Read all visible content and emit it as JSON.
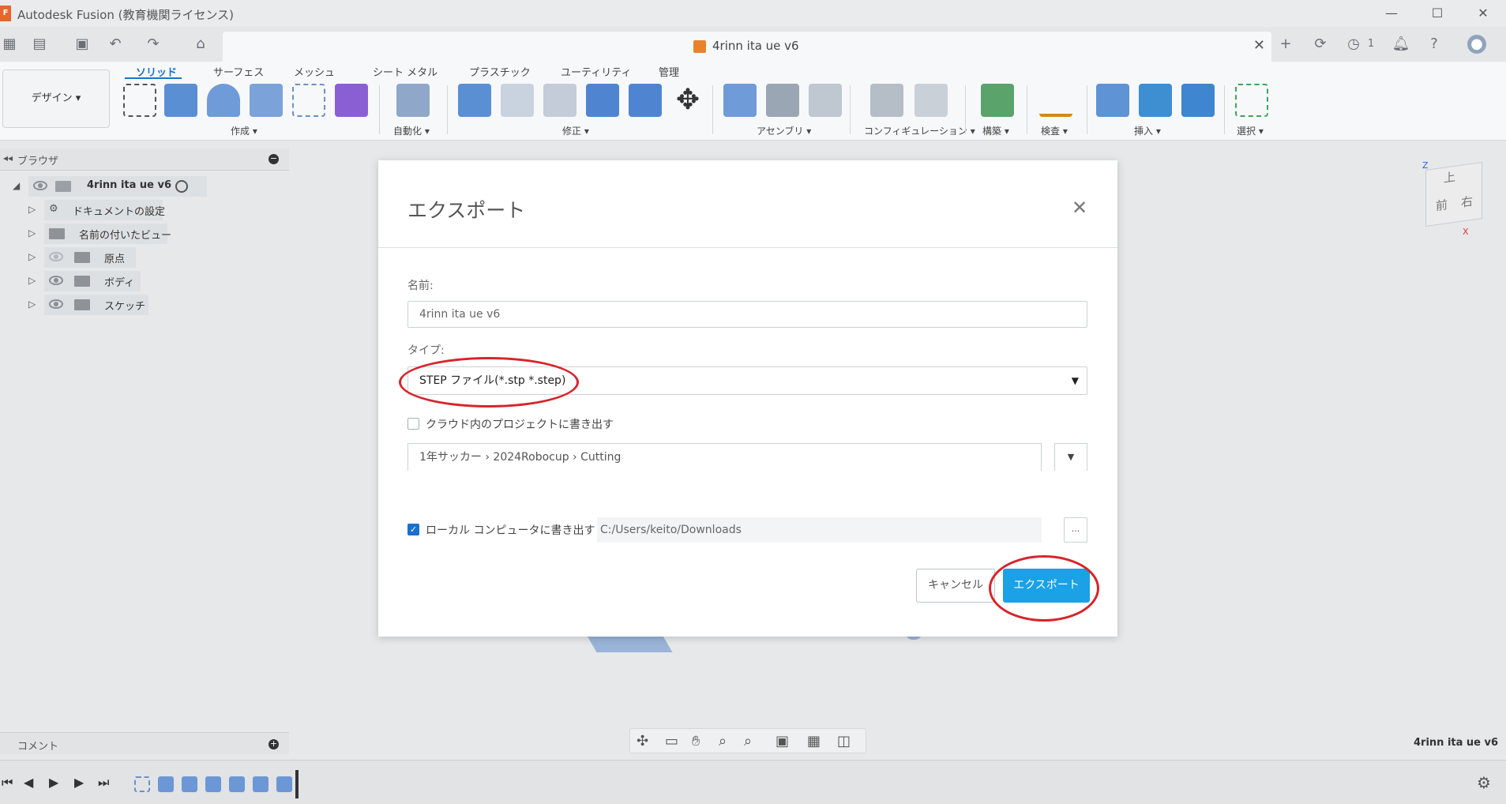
{
  "window": {
    "title": "Autodesk Fusion (教育機関ライセンス)",
    "logo": "F"
  },
  "tabbar": {
    "doc_tab_title": "4rinn ita ue v6",
    "jobs_count": "1"
  },
  "ribbon": {
    "workspace": "デザイン ▾",
    "tabs": [
      "ソリッド",
      "サーフェス",
      "メッシュ",
      "シート メタル",
      "プラスチック",
      "ユーティリティ",
      "管理"
    ],
    "groups": [
      "作成 ▾",
      "自動化 ▾",
      "修正 ▾",
      "アセンブリ ▾",
      "コンフィギュレーション ▾",
      "構築 ▾",
      "検査 ▾",
      "挿入 ▾",
      "選択 ▾"
    ]
  },
  "browser": {
    "title": "ブラウザ",
    "root": "4rinn ita ue v6",
    "items": [
      "ドキュメントの設定",
      "名前の付いたビュー",
      "原点",
      "ボディ",
      "スケッチ"
    ]
  },
  "comments": {
    "label": "コメント"
  },
  "viewcube": {
    "top": "上",
    "front": "前",
    "right": "右",
    "z": "Z",
    "x": "X"
  },
  "viewport": {
    "doc_name": "4rinn ita ue v6"
  },
  "dialog": {
    "title": "エクスポート",
    "name_label": "名前:",
    "name_value": "4rinn ita ue v6",
    "type_label": "タイプ:",
    "type_value": "STEP ファイル(*.stp *.step)",
    "cloud_label": "クラウド内のプロジェクトに書き出す",
    "cloud_path": "1年サッカー › 2024Robocup › Cutting",
    "local_label": "ローカル コンピュータに書き出す",
    "local_path": "C:/Users/keito/Downloads",
    "browse": "...",
    "cancel": "キャンセル",
    "export": "エクスポート"
  },
  "colors": {
    "accent": "#1a73c8",
    "export_button": "#1aa1e6",
    "annotation": "#d8242b"
  }
}
